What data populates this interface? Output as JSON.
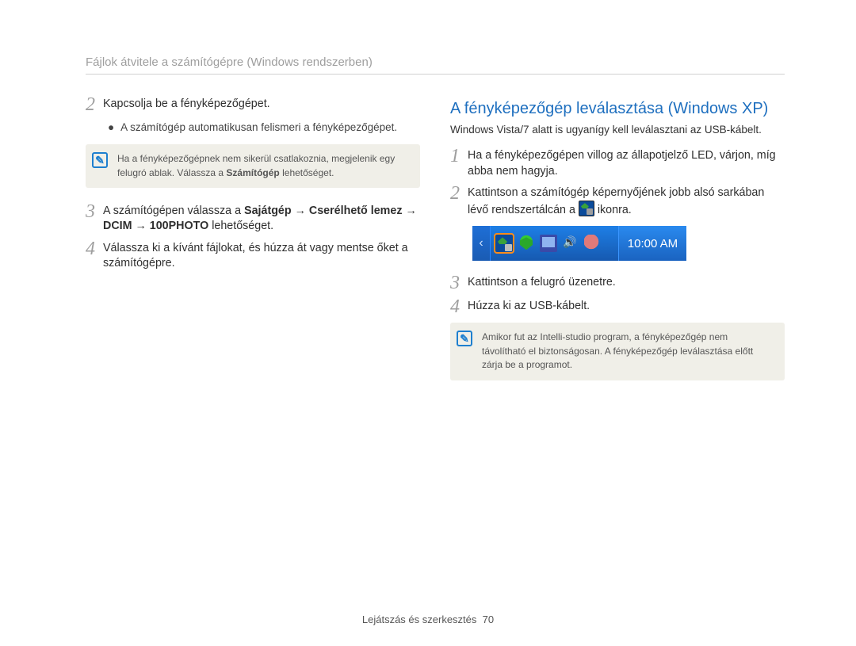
{
  "header": "Fájlok átvitele a számítógépre (Windows rendszerben)",
  "left": {
    "step2": {
      "num": "2",
      "text": "Kapcsolja be a fényképezőgépet."
    },
    "bullet1": "A számítógép automatikusan felismeri a fényképezőgépet.",
    "note1_a": "Ha a fényképezőgépnek nem sikerül csatlakoznia, megjelenik egy felugró ablak. Válassza a ",
    "note1_bold": "Számítógép",
    "note1_b": " lehetőséget.",
    "step3": {
      "num": "3",
      "pre": "A számítógépen válassza a ",
      "b1": "Sajátgép",
      "arr": " → ",
      "b2": "Cserélhető lemez",
      "b3": "DCIM",
      "b4": "100PHOTO",
      "post": " lehetőséget."
    },
    "step4": {
      "num": "4",
      "text": "Válassza ki a kívánt fájlokat, és húzza át vagy mentse őket a számítógépre."
    }
  },
  "right": {
    "title": "A fényképezőgép leválasztása (Windows XP)",
    "sub": "Windows Vista/7 alatt is ugyanígy kell leválasztani az USB-kábelt.",
    "step1": {
      "num": "1",
      "text": "Ha a fényképezőgépen villog az állapotjelző LED, várjon, míg abba nem hagyja."
    },
    "step2": {
      "num": "2",
      "pre": "Kattintson a számítógép képernyőjének jobb alsó sarkában lévő rendszertálcán a ",
      "post": " ikonra."
    },
    "clock": "10:00 AM",
    "step3": {
      "num": "3",
      "text": "Kattintson a felugró üzenetre."
    },
    "step4": {
      "num": "4",
      "text": "Húzza ki az USB-kábelt."
    },
    "note2": "Amikor fut az Intelli-studio program, a fényképezőgép nem távolítható el biztonságosan. A fényképezőgép leválasztása előtt zárja be a programot."
  },
  "footer": {
    "label": "Lejátszás és szerkesztés",
    "page": "70"
  }
}
